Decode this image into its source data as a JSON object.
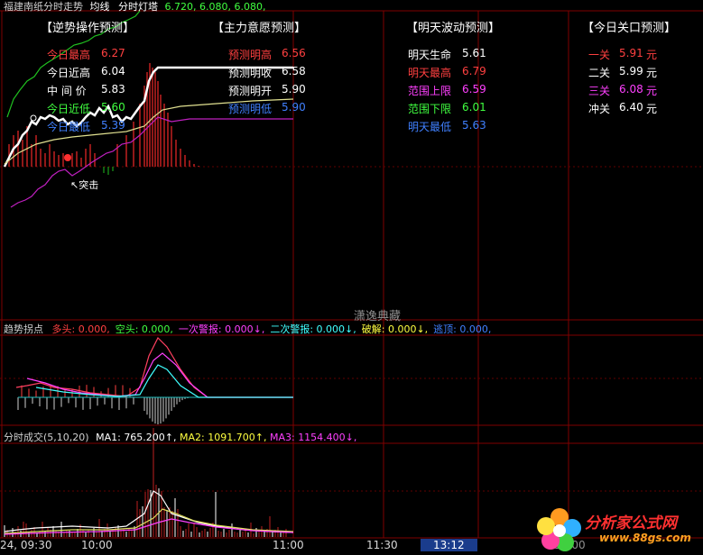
{
  "header": {
    "stock_name": "福建南纸分时走势",
    "line_avg": "均线",
    "lamp_label": "分时灯塔",
    "lamp_values": "6.720, 6.080, 6.080,"
  },
  "panels": {
    "reverse": "【逆势操作预测】",
    "main_force": "【主力意愿预测】",
    "tomorrow": "【明天波动预测】",
    "today_gate": "【今日关口预测】"
  },
  "reverse_rows": [
    {
      "label": "今日最高",
      "value": "6.27",
      "color": "#ff4040"
    },
    {
      "label": "今日近高",
      "value": "6.04",
      "color": "#ffffff"
    },
    {
      "label": "中 间 价",
      "value": "5.83",
      "color": "#ffffff"
    },
    {
      "label": "今日近低",
      "value": "5.60",
      "color": "#40ff40"
    },
    {
      "label": "今日最低",
      "value": "5.39",
      "color": "#4080ff"
    }
  ],
  "main_force_rows": [
    {
      "label": "预测明高",
      "value": "6.56",
      "color": "#ff4040"
    },
    {
      "label": "预测明收",
      "value": "6.58",
      "color": "#ffffff"
    },
    {
      "label": "预测明开",
      "value": "5.90",
      "color": "#ffffff"
    },
    {
      "label": "预测明低",
      "value": "5.90",
      "color": "#4080ff"
    }
  ],
  "tomorrow_rows": [
    {
      "label": "明天生命",
      "value": "5.61",
      "color": "#ffffff"
    },
    {
      "label": "明天最高",
      "value": "6.79",
      "color": "#ff4040"
    },
    {
      "label": "范围上限",
      "value": "6.59",
      "color": "#ff40ff"
    },
    {
      "label": "范围下限",
      "value": "6.01",
      "color": "#40ff40"
    },
    {
      "label": "明天最低",
      "value": "5.63",
      "color": "#4080ff"
    }
  ],
  "gate_rows": [
    {
      "label": "一关",
      "value": "5.91",
      "unit": "元",
      "color": "#ff4040"
    },
    {
      "label": "二关",
      "value": "5.99",
      "unit": "元",
      "color": "#ffffff"
    },
    {
      "label": "三关",
      "value": "6.08",
      "unit": "元",
      "color": "#ff40ff"
    },
    {
      "label": "冲关",
      "value": "6.40",
      "unit": "元",
      "color": "#ffffff"
    }
  ],
  "breakout_label": "突击",
  "watermark": "潇逸典藏",
  "indicator": {
    "title": "趋势拐点",
    "items": [
      {
        "label": "多头:",
        "value": "0.000,",
        "color": "#ff4040"
      },
      {
        "label": "空头:",
        "value": "0.000,",
        "color": "#40ff40"
      },
      {
        "label": "一次警报:",
        "value": "0.000↓,",
        "color": "#ff40ff"
      },
      {
        "label": "二次警报:",
        "value": "0.000↓,",
        "color": "#40ffff"
      },
      {
        "label": "破解:",
        "value": "0.000↓,",
        "color": "#ffff40"
      },
      {
        "label": "逃顶:",
        "value": "0.000,",
        "color": "#4080ff"
      }
    ]
  },
  "volume": {
    "title": "分时成交",
    "params": "(5,10,20)",
    "ma1_label": "MA1:",
    "ma1_value": "765.200↑,",
    "ma2_label": "MA2:",
    "ma2_value": "1091.700↑,",
    "ma3_label": "MA3:",
    "ma3_value": "1154.400↓,"
  },
  "time_axis": {
    "start": "24, 09:30",
    "t1": "10:00",
    "t2": "11:00",
    "t3": "11:30",
    "current": "13:12",
    "t4": "14:00"
  },
  "logo": {
    "text": "分析家公式网",
    "url_text": "www.88gs.com"
  }
}
